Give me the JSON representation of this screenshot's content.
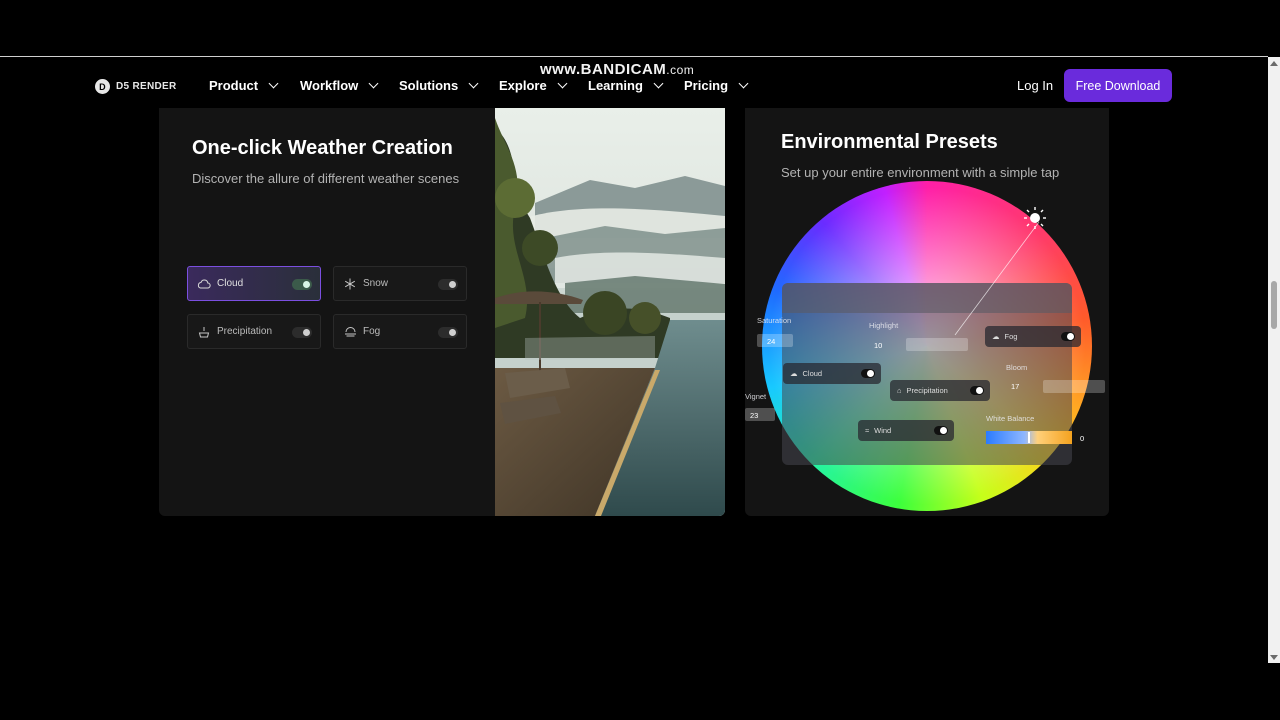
{
  "watermark": {
    "main": "www.BANDICAM",
    "domain": ".com"
  },
  "nav": {
    "logo": "D5 RENDER",
    "logo_mark": "D",
    "items": [
      {
        "label": "Product"
      },
      {
        "label": "Workflow"
      },
      {
        "label": "Solutions"
      },
      {
        "label": "Explore"
      },
      {
        "label": "Learning"
      },
      {
        "label": "Pricing"
      }
    ],
    "login": "Log In",
    "cta": "Free Download",
    "cta_color": "#6a2bdc"
  },
  "weather": {
    "title": "One-click Weather Creation",
    "subtitle": "Discover the allure of different weather scenes",
    "options": [
      {
        "label": "Cloud",
        "icon": "cloud-icon",
        "active": true
      },
      {
        "label": "Snow",
        "icon": "snowflake-icon",
        "active": false
      },
      {
        "label": "Precipitation",
        "icon": "rain-icon",
        "active": false
      },
      {
        "label": "Fog",
        "icon": "fog-icon",
        "active": false
      }
    ]
  },
  "presets": {
    "title": "Environmental Presets",
    "subtitle": "Set up your entire environment with a simple tap",
    "controls": {
      "saturation_label": "Saturation",
      "saturation_value": "24",
      "highlight_label": "Highlight",
      "highlight_value": "10",
      "fog_label": "Fog",
      "cloud_label": "Cloud",
      "precip_label": "Precipitation",
      "bloom_label": "Bloom",
      "bloom_value": "17",
      "vignette_label": "Vignet",
      "vignette_value": "23",
      "wind_label": "Wind",
      "wb_label": "White Balance",
      "wb_value": "0"
    }
  }
}
